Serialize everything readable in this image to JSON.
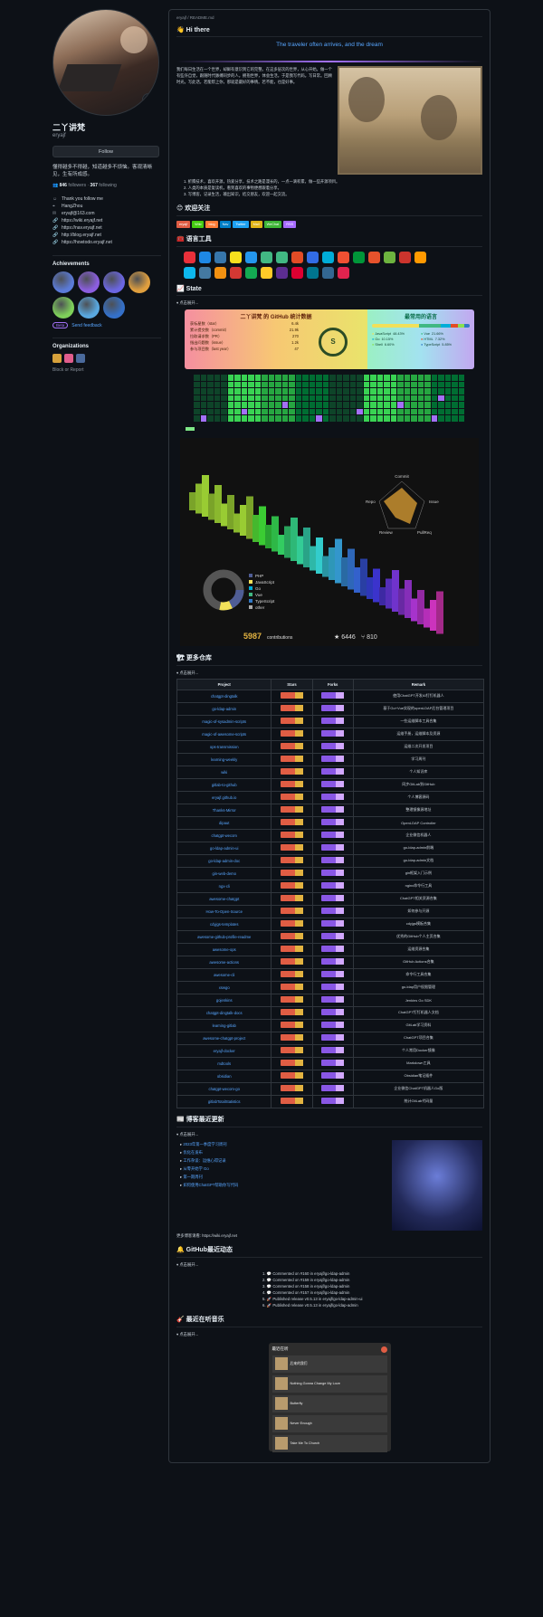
{
  "profile": {
    "name": "二丫讲梵",
    "login": "eryajf",
    "follow_label": "Follow",
    "bio": "懂得越多不得越，知道越多不烦恼。客观清晰见，生有所成感。",
    "followers": "846",
    "followers_label": "followers",
    "following": "367",
    "following_label": "following",
    "meta": [
      {
        "icon": "smile-icon",
        "text": "Thank you follow me"
      },
      {
        "icon": "location-icon",
        "text": "HangZhou"
      },
      {
        "icon": "mail-icon",
        "text": "eryajf@163.com"
      },
      {
        "icon": "link-icon",
        "text": "https://wiki.eryajf.net"
      },
      {
        "icon": "link-icon",
        "text": "https://nav.eryajf.net"
      },
      {
        "icon": "link-icon",
        "text": "http://blog.eryajf.net"
      },
      {
        "icon": "link-icon",
        "text": "https://howtodo.eryajf.net"
      }
    ],
    "achievements_title": "Achievements",
    "achievement_colors": [
      "#5b7bd8",
      "#8c5ee0",
      "#6b66e2",
      "#e09f3e",
      "#7ed05a",
      "#59a8e0",
      "#3470c8"
    ],
    "pro_label": "Beta",
    "pro_text": "Send feedback",
    "orgs_title": "Organizations",
    "org_colors": [
      "#d6a13b",
      "#e05d8c",
      "#4a6a9c"
    ],
    "block_label": "Block or Report"
  },
  "readme": {
    "filename": "eryajf / README.md",
    "greeting": "👋 Hi there",
    "typing": "The traveler often arrives, and the dream",
    "intro": "我们每日生活在一个世界，却鲜有意识到它的完整。在这多层次的世界，从心开始。做一个有些许自觉，跟随时代脉搏同步的人。拥抱世界，体会生活。于是我写代码。写日常。回顾时光。写此话，若能帮上你，那就是最好的事情。若不能，也是好事。",
    "list": [
      "1. 折腾技术，喜欢开源，热爱分享，技术之路是漫长的，一点一滴积累，做一些开源项目。",
      "2. 人类的本质是复读机，看到喜欢的事物便想跟着分享。",
      "3. 写博客，记录生活，输出知识，结交朋友，欢迎一起交流。"
    ],
    "wechat_title": "😊 欢迎关注",
    "tools_title": "🧰 语言工具",
    "state_title": "📈 State",
    "fold_label": "▾ 点击展开...",
    "more_title": "🏗 更多仓库",
    "blog_title": "📰 博客最近更新",
    "gh_title": "🔔 GitHub最近动态",
    "music_title": "🎸 最近在听音乐"
  },
  "chips": [
    {
      "label": "eryajf",
      "color": "#e05d44"
    },
    {
      "label": "Wiki",
      "color": "#4c1"
    },
    {
      "label": "blog",
      "color": "#fe7d37"
    },
    {
      "label": "Nav",
      "color": "#007ec6"
    },
    {
      "label": "Twitter",
      "color": "#1da1f2"
    },
    {
      "label": "Mail",
      "color": "#dfb317"
    },
    {
      "label": "WeChat",
      "color": "#3db536"
    },
    {
      "label": "RSS",
      "color": "#a66cff"
    }
  ],
  "tool_colors": [
    "#e8303a",
    "#1e88e5",
    "#3776ab",
    "#f7df1e",
    "#2496ed",
    "#42b883",
    "#41b883",
    "#e34c26",
    "#326ce5",
    "#00add8",
    "#f05032",
    "#009639",
    "#e6522c",
    "#6db33f",
    "#cc342d",
    "#ff9900",
    "#0db7ed",
    "#4479a1",
    "#f29111",
    "#d33833",
    "#13aa52",
    "#ffca28",
    "#5c2d91",
    "#dd0031",
    "#00758f",
    "#336791",
    "#e0234e"
  ],
  "stats": {
    "title": "二丫讲梵 的 GitHub 统计数据",
    "rows": [
      {
        "label": "获标星数（star）",
        "value": "6.4k"
      },
      {
        "label": "累计提交数（commit）",
        "value": "21.9k"
      },
      {
        "label": "拉取请求数（PR）",
        "value": "270"
      },
      {
        "label": "指出问题数（issue）",
        "value": "1.2k"
      },
      {
        "label": "参与项目数（last year）",
        "value": "47"
      }
    ],
    "rank": "S",
    "lang_title": "最常用的语言",
    "langs": [
      {
        "name": "JavaScript",
        "pct": "48.43%",
        "color": "#f1e05a"
      },
      {
        "name": "Vue",
        "pct": "21.66%",
        "color": "#41b883"
      },
      {
        "name": "Go",
        "pct": "10.15%",
        "color": "#00add8"
      },
      {
        "name": "HTML",
        "pct": "7.32%",
        "color": "#e34c26"
      },
      {
        "name": "Shell",
        "pct": "6.60%",
        "color": "#89e051"
      },
      {
        "name": "TypeScript",
        "pct": "5.85%",
        "color": "#3178c6"
      }
    ]
  },
  "isometric": {
    "contributions": "5987",
    "contributions_label": "contributions",
    "stars": "★ 6446",
    "forks": "⑂ 810",
    "radar_labels": [
      "Commit",
      "Issue",
      "PullReq",
      "Review",
      "Repo"
    ],
    "pie": [
      {
        "name": "PHP",
        "color": "#4f5d95"
      },
      {
        "name": "JavaScript",
        "color": "#f1e05a"
      },
      {
        "name": "Go",
        "color": "#00add8"
      },
      {
        "name": "Vue",
        "color": "#41b883"
      },
      {
        "name": "TypeScript",
        "color": "#3178c6"
      },
      {
        "name": "other",
        "color": "#aaaaaa"
      }
    ]
  },
  "repos_headers": [
    "Project",
    "Stars",
    "Forks",
    "Remark"
  ],
  "repos": [
    {
      "name": "chatgpt-dingtalk",
      "remark": "使用ChatGPT开发AI钉钉机器人"
    },
    {
      "name": "go-ldap-admin",
      "remark": "基于Go+Vue实现的openLDAP后台管理项目"
    },
    {
      "name": "magic-of-sysadmin-scripts",
      "remark": "一些运维脚本工具合集"
    },
    {
      "name": "magic-of-awesome-scripts",
      "remark": "运维手册，运维脚本及资源"
    },
    {
      "name": "ops-transmission",
      "remark": "运维二次开发项目"
    },
    {
      "name": "learning-weekly",
      "remark": "学习周刊"
    },
    {
      "name": "wiki",
      "remark": "个人知识库"
    },
    {
      "name": "gitlab-to-github",
      "remark": "同步GitLab到GitHub"
    },
    {
      "name": "eryajf.github.io",
      "remark": "个人博客源码"
    },
    {
      "name": "Thanks-Mirror",
      "remark": "整理镜像源地址"
    },
    {
      "name": "dipaut",
      "remark": "OpenLDAP Controller"
    },
    {
      "name": "chatgpt-wecom",
      "remark": "企业微信机器人"
    },
    {
      "name": "go-ldap-admin-ui",
      "remark": "go-ldap-admin前端"
    },
    {
      "name": "go-ldap-admin-doc",
      "remark": "go-ldap-admin文档"
    },
    {
      "name": "gin-web-demo",
      "remark": "gin框架入门示例"
    },
    {
      "name": "ngx-cli",
      "remark": "nginx命令行工具"
    },
    {
      "name": "awesome-chatgpt",
      "remark": "ChatGPT相关资源合集"
    },
    {
      "name": "How-To-Open-Source",
      "remark": "如何参与开源"
    },
    {
      "name": "cdyjgs-templates",
      "remark": "cdyjgs模板合集"
    },
    {
      "name": "awesome-github-profile-readme",
      "remark": "优秀的GitHub个人主页合集"
    },
    {
      "name": "awesome-ops",
      "remark": "运维资源合集"
    },
    {
      "name": "awesome-actions",
      "remark": "GitHub Actions合集"
    },
    {
      "name": "awesome-cli",
      "remark": "命令行工具合集"
    },
    {
      "name": "xswgo",
      "remark": "go-ldap用户权限管理"
    },
    {
      "name": "gojenkins",
      "remark": "Jenkins Go SDK"
    },
    {
      "name": "chatgpt-dingtalk-docs",
      "remark": "ChatGPT钉钉机器人文档"
    },
    {
      "name": "learning-gitlab",
      "remark": "GitLab学习资料"
    },
    {
      "name": "awesome-chatgpt-project",
      "remark": "ChatGPT项目合集"
    },
    {
      "name": "eryajf-docker",
      "remark": "个人常用Docker镜像"
    },
    {
      "name": "mdtools",
      "remark": "Markdown工具"
    },
    {
      "name": "obsidian",
      "remark": "Obsidian笔记插件"
    },
    {
      "name": "chatgpt-wecom-go",
      "remark": "企业微信ChatGPT机器人Go版"
    },
    {
      "name": "gitlabTotalStatistics",
      "remark": "统计GitLab代码量"
    }
  ],
  "blog": [
    "2023年第一季度学习周刊",
    "优化在发布",
    "工作杂谈：运维心得记录",
    "从零开始学 Go",
    "第一期周刊",
    "如何使用ChatGPT帮助你写代码"
  ],
  "blog_more": "更多博客请看: https://wiki.eryajf.net",
  "gh_activity": [
    "1. 💬 Commented on #160 in eryajf/go-ldap-admin",
    "2. 💬 Commented on #159 in eryajf/go-ldap-admin",
    "3. 💬 Commented on #158 in eryajf/go-ldap-admin",
    "4. 💬 Commented on #157 in eryajf/go-ldap-admin",
    "5. 🚀 Published release v0.5.13 in eryajf/go-ldap-admin-ui",
    "6. 🚀 Published release v0.5.13 in eryajf/go-ldap-admin"
  ],
  "player_title": "最近在听",
  "songs": [
    {
      "name": "后来的我们"
    },
    {
      "name": "Nothing Gonna Change My Love"
    },
    {
      "name": "Butterfly"
    },
    {
      "name": "Never Enough"
    },
    {
      "name": "Take Me To Church"
    }
  ]
}
